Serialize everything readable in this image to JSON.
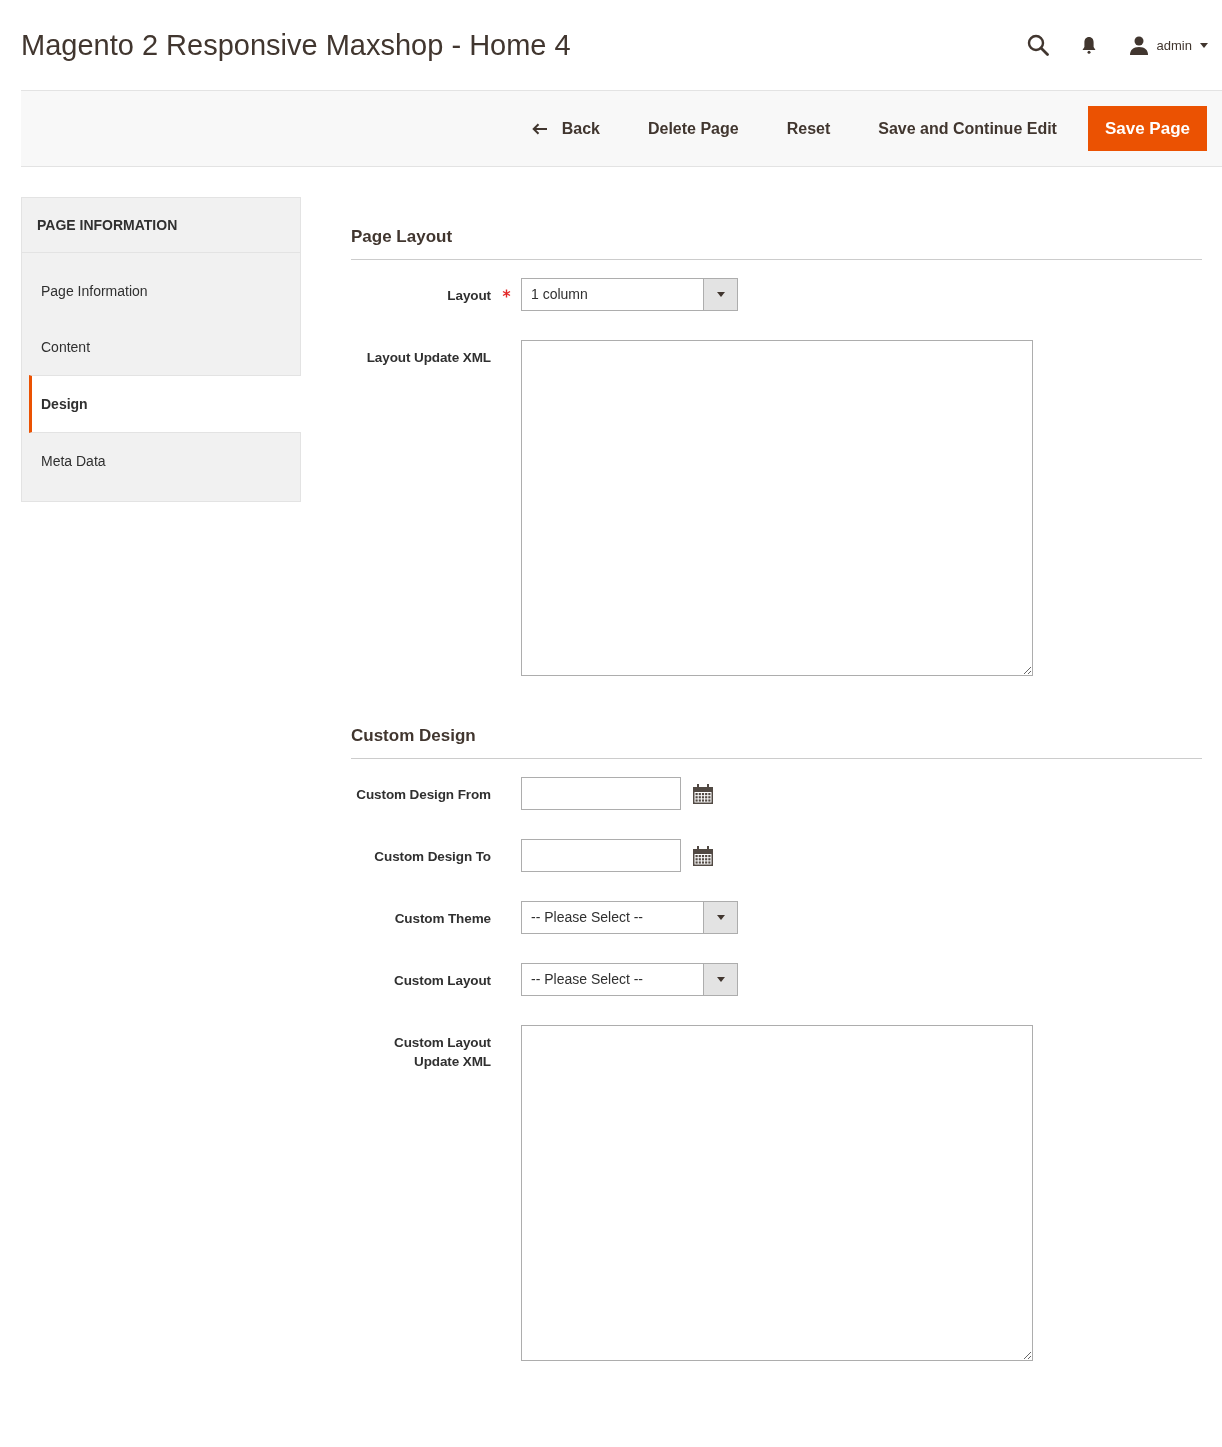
{
  "page_title": "Magento 2 Responsive Maxshop - Home 4",
  "user": {
    "name": "admin"
  },
  "actions": [
    {
      "label": "Back",
      "kind": "back"
    },
    {
      "label": "Delete Page",
      "kind": "link"
    },
    {
      "label": "Reset",
      "kind": "link"
    },
    {
      "label": "Save and Continue Edit",
      "kind": "link"
    },
    {
      "label": "Save Page",
      "kind": "primary"
    }
  ],
  "sidebar": {
    "title": "PAGE INFORMATION",
    "items": [
      {
        "label": "Page Information",
        "selected": false
      },
      {
        "label": "Content",
        "selected": false
      },
      {
        "label": "Design",
        "selected": true
      },
      {
        "label": "Meta Data",
        "selected": false
      }
    ]
  },
  "sections": [
    {
      "title": "Page Layout",
      "fields": [
        {
          "label": "Layout",
          "kind": "select",
          "required": true,
          "value": "1 column"
        },
        {
          "label": "Layout Update XML",
          "kind": "textarea",
          "required": false
        }
      ]
    },
    {
      "title": "Custom Design",
      "fields": [
        {
          "label": "Custom Design From",
          "kind": "date",
          "required": false
        },
        {
          "label": "Custom Design To",
          "kind": "date",
          "required": false
        },
        {
          "label": "Custom Theme",
          "kind": "select",
          "required": false,
          "value": "-- Please Select --"
        },
        {
          "label": "Custom Layout",
          "kind": "select",
          "required": false,
          "value": "-- Please Select --"
        },
        {
          "label": "Custom Layout Update XML",
          "kind": "textarea",
          "required": false
        }
      ]
    }
  ]
}
